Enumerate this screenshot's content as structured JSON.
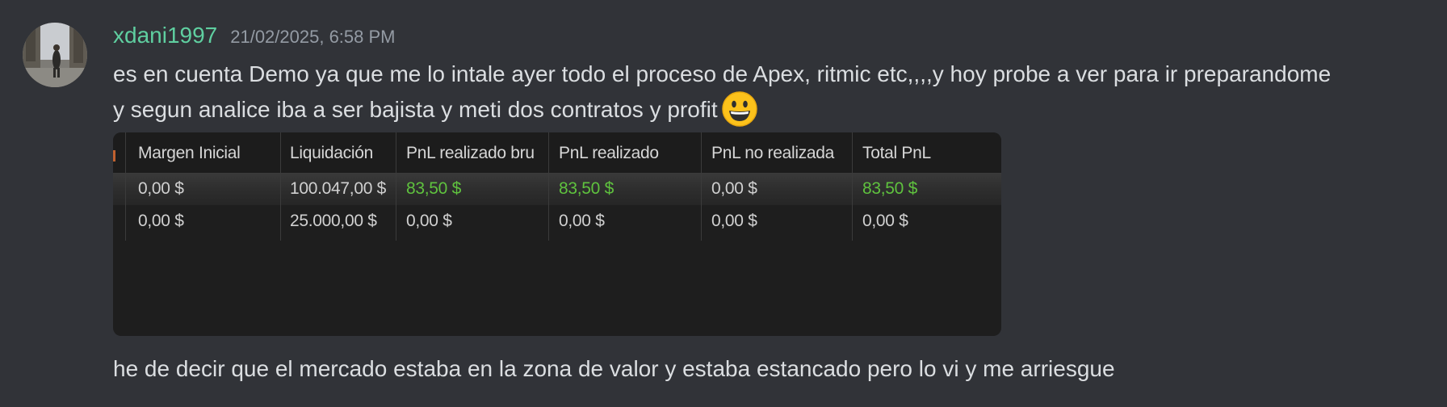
{
  "message": {
    "username": "xdani1997",
    "timestamp": "21/02/2025, 6:58 PM",
    "line1": "es en cuenta Demo ya que me lo intale ayer todo el proceso de Apex, ritmic etc,,,,y hoy probe a ver para ir preparandome",
    "line2": "y segun analice iba a ser bajista y meti dos contratos y profit",
    "emoji": "grinning-face",
    "line3": "he de decir que el mercado estaba en la zona de valor  y estaba estancado pero lo vi y me arriesgue"
  },
  "attachment": {
    "columns": [
      "Margen Inicial",
      "Liquidación",
      "PnL realizado bru",
      "PnL realizado",
      "PnL no realizada",
      "Total PnL"
    ],
    "rows": [
      [
        "0,00 $",
        "100.047,00 $",
        "83,50 $",
        "83,50 $",
        "0,00 $",
        "83,50 $"
      ],
      [
        "0,00 $",
        "25.000,00 $",
        "0,00 $",
        "0,00 $",
        "0,00 $",
        "0,00 $"
      ]
    ],
    "positive_color": "#5fc23e"
  },
  "colors": {
    "background": "#313338",
    "username": "#5fcfa0",
    "text": "#dbdee1",
    "timestamp": "#949ba4"
  }
}
